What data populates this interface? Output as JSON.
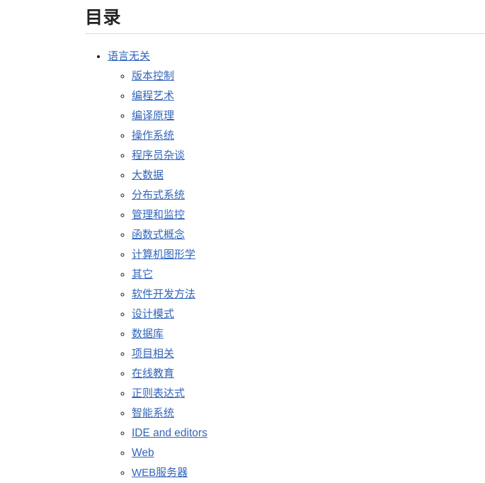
{
  "page": {
    "title": "目录",
    "heading_color": "#222222",
    "link_color": "#3366bb",
    "background_color": "#ffffff",
    "rule_color": "#dcdcdc"
  },
  "toc": {
    "root": {
      "label": "语言无关",
      "children": [
        {
          "label": "版本控制"
        },
        {
          "label": "编程艺术"
        },
        {
          "label": "编译原理"
        },
        {
          "label": "操作系统"
        },
        {
          "label": "程序员杂谈"
        },
        {
          "label": "大数据"
        },
        {
          "label": "分布式系统"
        },
        {
          "label": "管理和监控"
        },
        {
          "label": "函数式概念"
        },
        {
          "label": "计算机图形学"
        },
        {
          "label": "其它"
        },
        {
          "label": "软件开发方法"
        },
        {
          "label": "设计模式"
        },
        {
          "label": "数据库"
        },
        {
          "label": "项目相关"
        },
        {
          "label": "在线教育"
        },
        {
          "label": "正则表达式"
        },
        {
          "label": "智能系统"
        },
        {
          "label": "IDE and editors"
        },
        {
          "label": "Web"
        },
        {
          "label": "WEB服务器"
        }
      ]
    }
  }
}
